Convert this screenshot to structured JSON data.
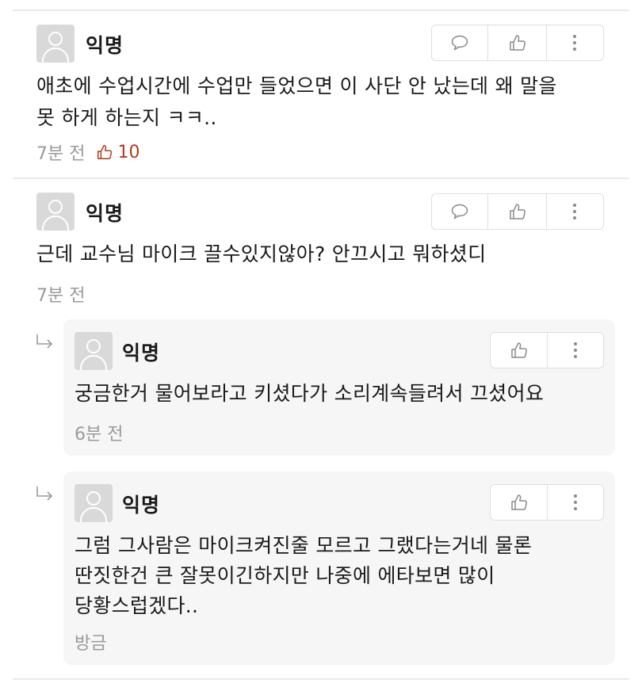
{
  "comments": [
    {
      "author": "익명",
      "lines": [
        "애초에 수업시간에 수업만 들었으면 이 사단 안 났는데 왜 말을",
        "못 하게 하는지 ㅋㅋ.."
      ],
      "time": "7분 전",
      "likes": "10"
    },
    {
      "author": "익명",
      "lines": [
        "근데 교수님 마이크 끌수있지않아? 안끄시고 뭐하셨디"
      ],
      "time": "7분 전"
    }
  ],
  "replies": [
    {
      "author": "익명",
      "lines": [
        "궁금한거 물어보라고 키셨다가 소리계속들려서 끄셨어요"
      ],
      "time": "6분 전"
    },
    {
      "author": "익명",
      "lines": [
        "그럼 그사람은 마이크켜진줄 모르고 그랬다는거네 물론",
        "딴짓한건 큰 잘못이긴하지만 나중에 에타보면 많이",
        "당황스럽겠다.."
      ],
      "time": "방금"
    }
  ],
  "icons": {
    "comment": "speech-bubble-icon",
    "like": "thumbs-up-icon",
    "more": "vertical-dots-icon",
    "reply": "reply-arrow-icon"
  },
  "colors": {
    "likes": "#b23a1e",
    "meta": "#9a9a9a",
    "reply_bg": "#f6f6f7"
  }
}
